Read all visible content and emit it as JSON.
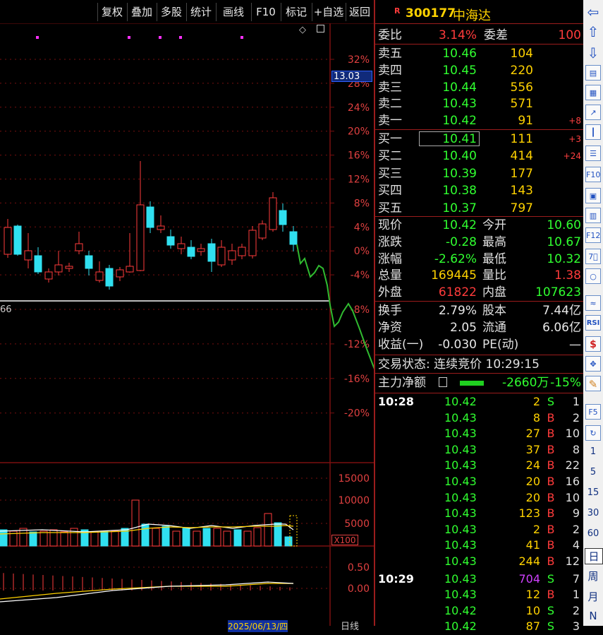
{
  "toolbar": {
    "buttons": [
      "复权",
      "叠加",
      "多股",
      "统计",
      "画线",
      "F10",
      "标记",
      "+自选",
      "返回"
    ]
  },
  "kline": {
    "axis_pct": [
      "32%",
      "28%",
      "24%",
      "20%",
      "16%",
      "12%",
      "8%",
      "4%",
      "0%",
      "-4%",
      "-8%",
      "-12%",
      "-16%",
      "-20%"
    ],
    "price_tag": "13.03",
    "left_label": "66",
    "volume_axis": [
      "15000",
      "10000",
      "5000"
    ],
    "volume_unit": "X100",
    "macd_axis": [
      "0.50",
      "0.00"
    ],
    "bottom_date": "2025/06/13/四",
    "bottom_period": "日线"
  },
  "header": {
    "badge": "R",
    "code": "300177",
    "name": "中海达",
    "webi_label": "委比",
    "webi_value": "3.14%",
    "weicha_label": "委差",
    "weicha_value": "100"
  },
  "asks": [
    {
      "label": "卖五",
      "price": "10.46",
      "vol": "104",
      "chg": ""
    },
    {
      "label": "卖四",
      "price": "10.45",
      "vol": "220",
      "chg": ""
    },
    {
      "label": "卖三",
      "price": "10.44",
      "vol": "556",
      "chg": ""
    },
    {
      "label": "卖二",
      "price": "10.43",
      "vol": "571",
      "chg": ""
    },
    {
      "label": "卖一",
      "price": "10.42",
      "vol": "91",
      "chg": "+8"
    }
  ],
  "bids": [
    {
      "label": "买一",
      "price": "10.41",
      "vol": "111",
      "chg": "+3"
    },
    {
      "label": "买二",
      "price": "10.40",
      "vol": "414",
      "chg": "+24"
    },
    {
      "label": "买三",
      "price": "10.39",
      "vol": "177",
      "chg": ""
    },
    {
      "label": "买四",
      "price": "10.38",
      "vol": "143",
      "chg": ""
    },
    {
      "label": "买五",
      "price": "10.37",
      "vol": "797",
      "chg": ""
    }
  ],
  "stats": [
    {
      "l1": "现价",
      "v1": "10.42",
      "c1": "green",
      "l2": "今开",
      "v2": "10.60",
      "c2": "green"
    },
    {
      "l1": "涨跌",
      "v1": "-0.28",
      "c1": "green",
      "l2": "最高",
      "v2": "10.67",
      "c2": "green"
    },
    {
      "l1": "涨幅",
      "v1": "-2.62%",
      "c1": "green",
      "l2": "最低",
      "v2": "10.32",
      "c2": "green"
    },
    {
      "l1": "总量",
      "v1": "169445",
      "c1": "yellow",
      "l2": "量比",
      "v2": "1.38",
      "c2": "red"
    },
    {
      "l1": "外盘",
      "v1": "61822",
      "c1": "red",
      "l2": "内盘",
      "v2": "107623",
      "c2": "green"
    }
  ],
  "stats2": [
    {
      "l1": "换手",
      "v1": "2.79%",
      "l2": "股本",
      "v2": "7.44亿"
    },
    {
      "l1": "净资",
      "v1": "2.05",
      "l2": "流通",
      "v2": "6.06亿"
    },
    {
      "l1": "收益(一)",
      "v1": "-0.030",
      "l2": "PE(动)",
      "v2": "—"
    }
  ],
  "trade_status": "交易状态: 连续竞价 10:29:15",
  "main_force": {
    "label": "主力净额",
    "value": "-2660万",
    "pct": "-15%"
  },
  "ticks": [
    {
      "time": "10:28",
      "price": "10.42",
      "vol": "2",
      "dir": "S",
      "n": "1"
    },
    {
      "time": "",
      "price": "10.43",
      "vol": "8",
      "dir": "B",
      "n": "2"
    },
    {
      "time": "",
      "price": "10.43",
      "vol": "27",
      "dir": "B",
      "n": "10"
    },
    {
      "time": "",
      "price": "10.43",
      "vol": "37",
      "dir": "B",
      "n": "8"
    },
    {
      "time": "",
      "price": "10.43",
      "vol": "24",
      "dir": "B",
      "n": "22"
    },
    {
      "time": "",
      "price": "10.43",
      "vol": "20",
      "dir": "B",
      "n": "16"
    },
    {
      "time": "",
      "price": "10.43",
      "vol": "20",
      "dir": "B",
      "n": "10"
    },
    {
      "time": "",
      "price": "10.43",
      "vol": "123",
      "dir": "B",
      "n": "9"
    },
    {
      "time": "",
      "price": "10.43",
      "vol": "2",
      "dir": "B",
      "n": "2"
    },
    {
      "time": "",
      "price": "10.43",
      "vol": "41",
      "dir": "B",
      "n": "4"
    },
    {
      "time": "",
      "price": "10.43",
      "vol": "244",
      "dir": "B",
      "n": "12"
    },
    {
      "time": "10:29",
      "price": "10.43",
      "vol": "704",
      "dir": "S",
      "n": "7"
    },
    {
      "time": "",
      "price": "10.43",
      "vol": "12",
      "dir": "B",
      "n": "1"
    },
    {
      "time": "",
      "price": "10.42",
      "vol": "10",
      "dir": "S",
      "n": "2"
    },
    {
      "time": "",
      "price": "10.42",
      "vol": "87",
      "dir": "S",
      "n": "3"
    }
  ],
  "sidebar": {
    "periods": [
      "1",
      "5",
      "15",
      "30",
      "60",
      "日",
      "周",
      "月",
      "N"
    ],
    "icons": [
      "arrow-left-icon",
      "arrow-up-icon",
      "arrow-down-icon",
      "quote-list-icon",
      "grid-icon",
      "line-chart-icon",
      "candle-icon",
      "table-icon",
      "f10-icon",
      "news-icon",
      "book-icon",
      "f12-icon",
      "f10-alt-icon",
      "circle-icon",
      "wave-icon",
      "rsi-icon",
      "dollar-icon",
      "move-icon",
      "pencil-icon",
      "f5-icon",
      "refresh-icon"
    ],
    "rsi_label": "RSI",
    "f10_label": "F10",
    "f12_label": "F12",
    "f5_label": "F5"
  },
  "colors": {
    "up": "#ff3b3b",
    "down": "#30e0f0",
    "grid": "#7a1010",
    "ma5": "#ffffff",
    "ma10": "#ffd200",
    "trend": "#22aa22"
  }
}
